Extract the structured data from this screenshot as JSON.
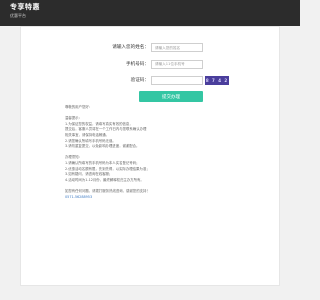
{
  "header": {
    "title": "专享特惠",
    "subtitle": "优惠平台"
  },
  "form": {
    "name_label": "请输入您的姓名：",
    "name_placeholder": "请输入您的姓名",
    "phone_label": "手机号码：",
    "phone_placeholder": "请输入11位手机号",
    "captcha_label": "验证码：",
    "captcha_placeholder": "",
    "captcha_image_text": "8 7 4 2",
    "submit_label": "提交办理"
  },
  "notes": [
    "尊敬的用户您好：",
    "",
    "温馨提示：",
    "1.为保证您的权益，请填写真实有效的信息，",
    "提交后，客服人员将在一个工作日内与您联系确认办理",
    "相关事宜，请保持电话畅通。",
    "2.请您确认所填写手机号码无误。",
    "3.请勿重复提交，以免影响办理进度，谢谢配合。",
    "",
    "办理须知：",
    "1.请确认所填写的手机号码为本人实名登记号码；",
    "2.优惠活动名额有限，先到先得，以实际办理结果为准；",
    "3.如有疑问，请咨询在线客服；",
    "4.活动时间为1-12月份，最终解释权归主办方所有。",
    "",
    "如您有任何问题，请拨打服务热线咨询，感谢您的支持！",
    "0571-56288953"
  ],
  "colors": {
    "header_bg": "#2c2c2c",
    "button_bg": "#34c6a3",
    "captcha_bg": "#4a3e9c",
    "link": "#3a78c2"
  }
}
